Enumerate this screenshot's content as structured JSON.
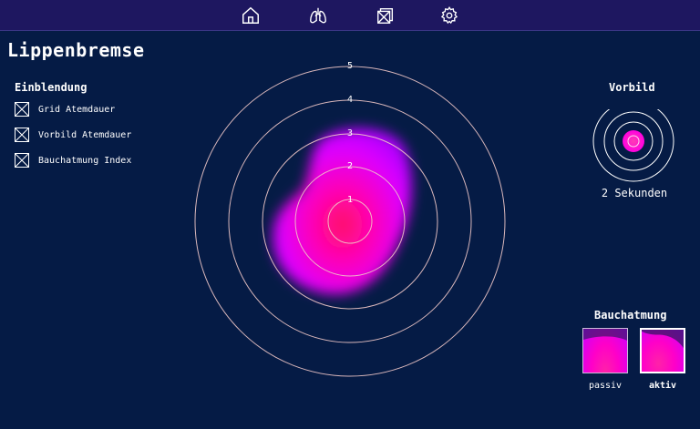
{
  "app": {
    "title": "Lippenbremse",
    "accent": "#ff00c8",
    "background": "#051b45",
    "topbar_color": "#1e1760"
  },
  "nav": {
    "items": [
      {
        "icon": "home-icon"
      },
      {
        "icon": "lungs-icon"
      },
      {
        "icon": "image-stack-icon"
      },
      {
        "icon": "gear-icon"
      }
    ]
  },
  "einblendung": {
    "title": "Einblendung",
    "options": [
      {
        "label": "Grid Atemdauer",
        "checked": true
      },
      {
        "label": "Vorbild Atemdauer",
        "checked": true
      },
      {
        "label": "Bauchatmung Index",
        "checked": true
      }
    ]
  },
  "radar": {
    "rings": [
      "1",
      "2",
      "3",
      "4",
      "5"
    ]
  },
  "vorbild": {
    "title": "Vorbild",
    "duration": "2 Sekunden"
  },
  "bauchatmung": {
    "title": "Bauchatmung",
    "passiv_label": "passiv",
    "aktiv_label": "aktiv",
    "selected": "aktiv"
  }
}
